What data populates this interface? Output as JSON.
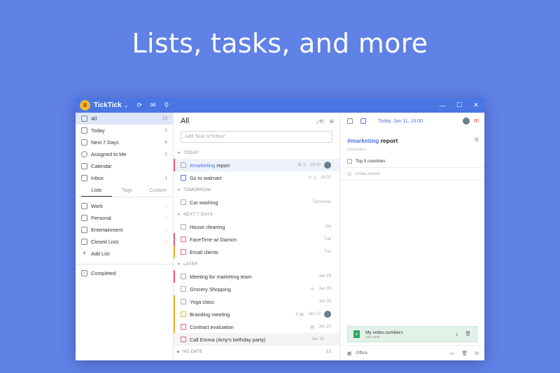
{
  "headline": "Lists, tasks, and more",
  "app": {
    "name": "TickTick"
  },
  "colors": {
    "background": "#6081e6",
    "titlebar": "#4a76e4",
    "accent": "#4a76e4",
    "selected": "#dfe6fa"
  },
  "titlebar_icons": [
    "sync-icon",
    "mail-icon",
    "search-icon"
  ],
  "window_controls": [
    "minimize-icon",
    "maximize-icon",
    "close-icon"
  ],
  "sidebar": {
    "smart_lists": [
      {
        "label": "All",
        "count": "23",
        "icon": "all-icon"
      },
      {
        "label": "Today",
        "count": "2",
        "icon": "today-icon"
      },
      {
        "label": "Next 7 Days",
        "count": "6",
        "icon": "week-icon"
      },
      {
        "label": "Assigned to Me",
        "count": "2",
        "icon": "person-icon"
      },
      {
        "label": "Calendar",
        "count": "",
        "icon": "calendar-icon"
      },
      {
        "label": "Inbox",
        "count": "1",
        "icon": "inbox-icon"
      }
    ],
    "tabs": [
      "Lists",
      "Tags",
      "Custom"
    ],
    "folders": [
      {
        "label": "Work",
        "icon": "folder-icon"
      },
      {
        "label": "Personal",
        "icon": "folder-icon"
      },
      {
        "label": "Entertainment",
        "icon": "folder-icon"
      },
      {
        "label": "Closed Lists",
        "icon": "folder-icon"
      }
    ],
    "add_list": "Add List",
    "completed": "Completed"
  },
  "middle": {
    "title": "All",
    "add_placeholder": "Add Task to\"Inbox\"",
    "sections": {
      "today": "TODAY",
      "tomorrow": "TOMORROW",
      "next7": "NEXT 7 DAYS",
      "later": "LATER",
      "nodate": "NO DATE",
      "nodate_count": "11"
    },
    "tasks": {
      "t0": {
        "tag": "#marketing",
        "title": " report",
        "date": "16:00",
        "color": "#e85d8a"
      },
      "t1": {
        "title": "Go to walmart",
        "date": "18:30",
        "color": ""
      },
      "t2": {
        "title": "Car washing",
        "date": "Tomorrow",
        "color": ""
      },
      "t3": {
        "title": "House cleaning",
        "date": "Sat",
        "color": ""
      },
      "t4": {
        "title": "FaceTime w/ Damon",
        "date": "Tue",
        "color": "#e85d8a"
      },
      "t5": {
        "title": "Email clients",
        "date": "Tue",
        "color": "#f2b136"
      },
      "t6": {
        "title": "Meeting for marketing team",
        "date": "Jan 19",
        "color": "#e85d8a"
      },
      "t7": {
        "title": "Grocery Shopping",
        "date": "Jan 20",
        "color": ""
      },
      "t8": {
        "title": "Yoga class",
        "date": "Jan 20",
        "color": "#f2b136"
      },
      "t9": {
        "title": "Branding meeting",
        "date": "Jan 22",
        "color": "#f2b136"
      },
      "t10": {
        "title": "Contract evaluation",
        "date": "Jan 22",
        "color": "#f2b136"
      },
      "t11": {
        "title": "Call Emma (Amy's birthday party)",
        "date": "Jan 24",
        "color": ""
      }
    }
  },
  "detail": {
    "date": "Today, Jan 11, 16:00",
    "priority": "!!!",
    "tag": "#marketing",
    "title": " report",
    "description_placeholder": "Description",
    "checklist": [
      {
        "label": "Top 5 countries",
        "done": false
      },
      {
        "label": "Xmas promo",
        "done": true
      }
    ],
    "attachment": {
      "name": "My notes.numbers",
      "size": "105.73KB"
    },
    "list_name": "Office"
  }
}
